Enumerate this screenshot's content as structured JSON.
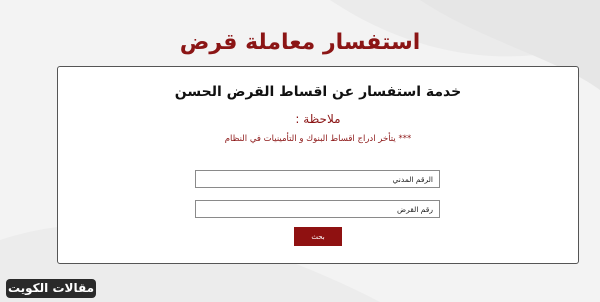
{
  "page": {
    "title": "استفسار معاملة قرض"
  },
  "form": {
    "heading": "خدمة استفسار عن اقساط القرض الحسن",
    "note_label": "ملاحظة :",
    "note_text": "*** يتأخر ادراج اقساط البنوك و التأمينيات في النظام",
    "civil_id_placeholder": "الرقم المدني",
    "loan_number_placeholder": "رقم القرض",
    "search_label": "بحث"
  },
  "brand": {
    "label": "مقالات الكويت"
  },
  "colors": {
    "accent": "#8b1515",
    "button": "#8f1111",
    "background": "#f3f3f3"
  }
}
